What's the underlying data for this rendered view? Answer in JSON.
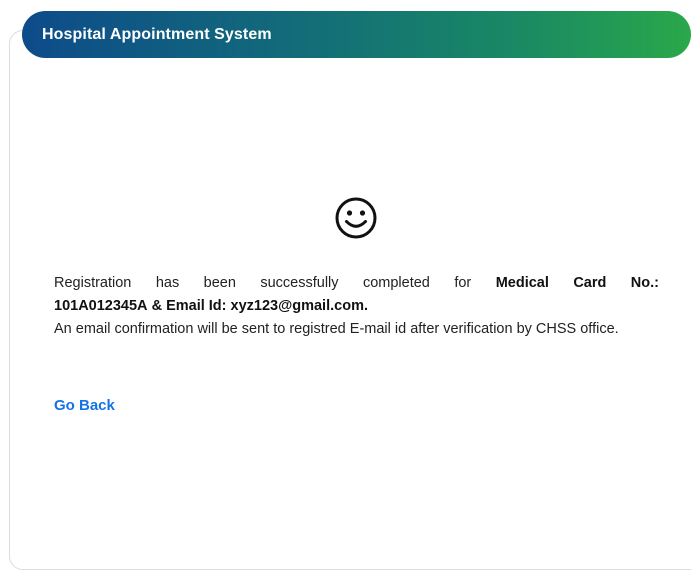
{
  "header": {
    "title": "Hospital Appointment System"
  },
  "status_icon": "smiley-face-icon",
  "message": {
    "part1": "Registration has been successfully completed for",
    "card_label": "Medical Card No.:",
    "card_number": "101A012345A",
    "email_label": "& Email Id:",
    "email": "xyz123@gmail.com.",
    "confirmation": "An email confirmation will be sent to registred E-mail id after verification by CHSS office."
  },
  "go_back_label": "Go Back",
  "colors": {
    "header_start": "#0d4b8a",
    "header_end": "#2aa84a",
    "link": "#1673e6"
  }
}
